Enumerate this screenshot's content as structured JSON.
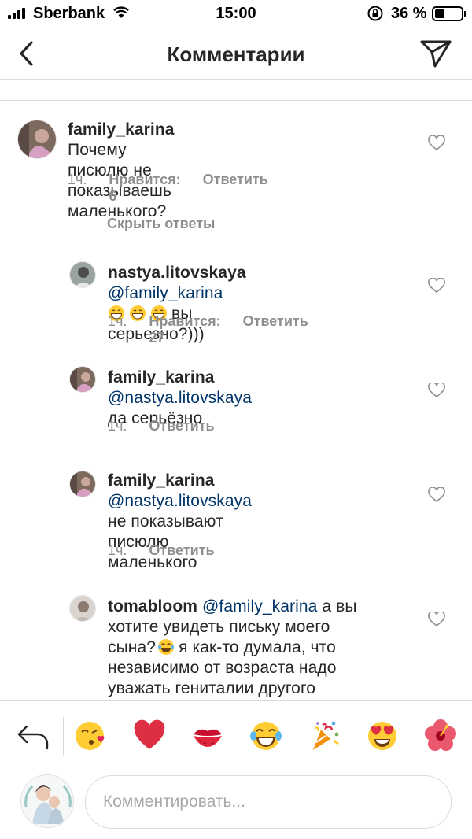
{
  "status_bar": {
    "carrier": "Sberbank",
    "time": "15:00",
    "battery_percent": "36 %",
    "battery_level": 0.36
  },
  "header": {
    "title": "Комментарии"
  },
  "comments": [
    {
      "username": "family_karina",
      "text": "Почему писюлю не",
      "text2": "показываешь маленького?",
      "time": "1ч.",
      "likes": "Нравится: 6",
      "reply": "Ответить"
    }
  ],
  "hide_replies": "Скрыть ответы",
  "replies": [
    {
      "username": "nastya.litovskaya",
      "mention": "@family_karina",
      "text": "вы серьезно?)))",
      "emojis": [
        "grinning-emoji",
        "grinning-emoji",
        "grinning-emoji"
      ],
      "time": "1ч.",
      "likes": "Нравится: 27",
      "reply": "Ответить"
    },
    {
      "username": "family_karina",
      "mention": "@nastya.litovskaya",
      "text": "да серьёзно",
      "time": "1ч.",
      "reply": "Ответить"
    },
    {
      "username": "family_karina",
      "mention": "@nastya.litovskaya",
      "text": "не показывают писюлю",
      "text2": "маленького",
      "time": "1ч.",
      "reply": "Ответить"
    },
    {
      "username": "tomabloom",
      "mention": "@family_karina",
      "text_a": "а вы",
      "text_b": "хотите увидеть письку моего",
      "text_c": "сына?",
      "text_d": "я как-то думала, что",
      "text_e": "независимо от возраста надо",
      "text_f": "уважать гениталии другого"
    }
  ],
  "emoji_bar": [
    "kissing-heart-emoji",
    "red-heart-emoji",
    "kiss-mark-emoji",
    "tears-of-joy-emoji",
    "party-popper-emoji",
    "heart-eyes-emoji",
    "hibiscus-emoji"
  ],
  "input": {
    "placeholder": "Комментировать..."
  },
  "colors": {
    "mention": "#003569",
    "meta": "#8e8e8e",
    "text": "#262626"
  }
}
